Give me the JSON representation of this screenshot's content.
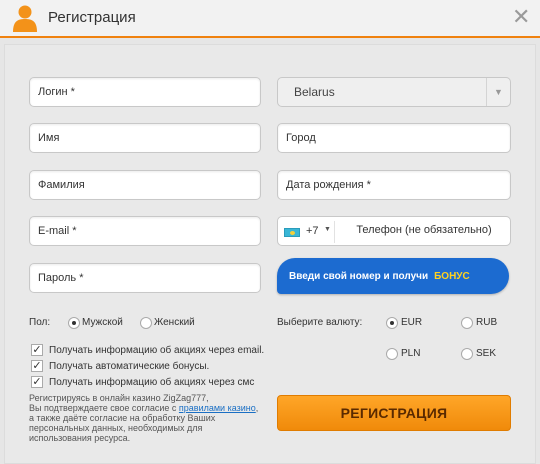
{
  "header": {
    "title": "Регистрация",
    "close": "✕",
    "icon": "user-icon",
    "accent": "#f0820f"
  },
  "fields": {
    "login": "Логин *",
    "first_name": "Имя",
    "last_name": "Фамилия",
    "email": "E-mail *",
    "password": "Пароль *",
    "city": "Город",
    "birth_date": "Дата рождения *"
  },
  "country": {
    "value": "Belarus"
  },
  "phone": {
    "code": "+7",
    "placeholder": "Телефон (не обязательно)",
    "flag_icon": "kazakhstan-flag-icon"
  },
  "bonus_banner": {
    "text": "Введи свой номер и получи",
    "highlight": "БОНУС",
    "color": "#1c6bd0"
  },
  "gender": {
    "label": "Пол:",
    "options": [
      {
        "label": "Мужской",
        "selected": true
      },
      {
        "label": "Женский",
        "selected": false
      }
    ]
  },
  "currency": {
    "label": "Выберите валюту:",
    "options": [
      {
        "label": "EUR",
        "selected": true
      },
      {
        "label": "RUB",
        "selected": false
      },
      {
        "label": "PLN",
        "selected": false
      },
      {
        "label": "SEK",
        "selected": false
      }
    ]
  },
  "checkboxes": [
    {
      "label": "Получать информацию об акциях через email.",
      "checked": true
    },
    {
      "label": "Получать автоматические бонусы.",
      "checked": true
    },
    {
      "label": "Получать информацию об акциях через смс",
      "checked": true
    }
  ],
  "disclaimer": {
    "line1": "Регистрируясь в онлайн казино ZigZag777,",
    "line2_pre": "Вы подтверждаете свое согласие с ",
    "link": "правилами казино",
    "line2_post": ", а также даёте согласие на обработку Ваших персональных данных, необходимых для использования ресурса."
  },
  "submit": {
    "label": "РЕГИСТРАЦИЯ",
    "color": "#f08a0a"
  }
}
